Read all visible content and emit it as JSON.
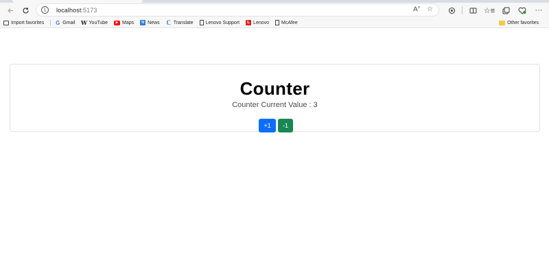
{
  "browser": {
    "url_host": "localhost",
    "url_port": ":5173",
    "bookmarks": [
      {
        "label": "Import favorites",
        "icon": "import-icon"
      },
      {
        "label": "Gmail",
        "icon": "google-icon"
      },
      {
        "label": "YouTube",
        "icon": "wikipedia-icon"
      },
      {
        "label": "Maps",
        "icon": "youtube-icon"
      },
      {
        "label": "News",
        "icon": "news-icon"
      },
      {
        "label": "Translate",
        "icon": "translate-icon"
      },
      {
        "label": "Lenovo Support",
        "icon": "page-icon"
      },
      {
        "label": "Lenovo",
        "icon": "lenovo-icon"
      },
      {
        "label": "McAfee",
        "icon": "page-icon"
      }
    ],
    "other_favorites": "Other favorites",
    "colors": {
      "youtube": "#ff0000",
      "lenovo": "#e2231a",
      "news": "#2b7cd3",
      "folder": "#f2c94c"
    }
  },
  "app": {
    "title": "Counter",
    "value_line": "Counter Current Value : 3",
    "increment_label": "+1",
    "decrement_label": "-1",
    "colors": {
      "increment": "#0d6efd",
      "decrement": "#198754"
    }
  }
}
